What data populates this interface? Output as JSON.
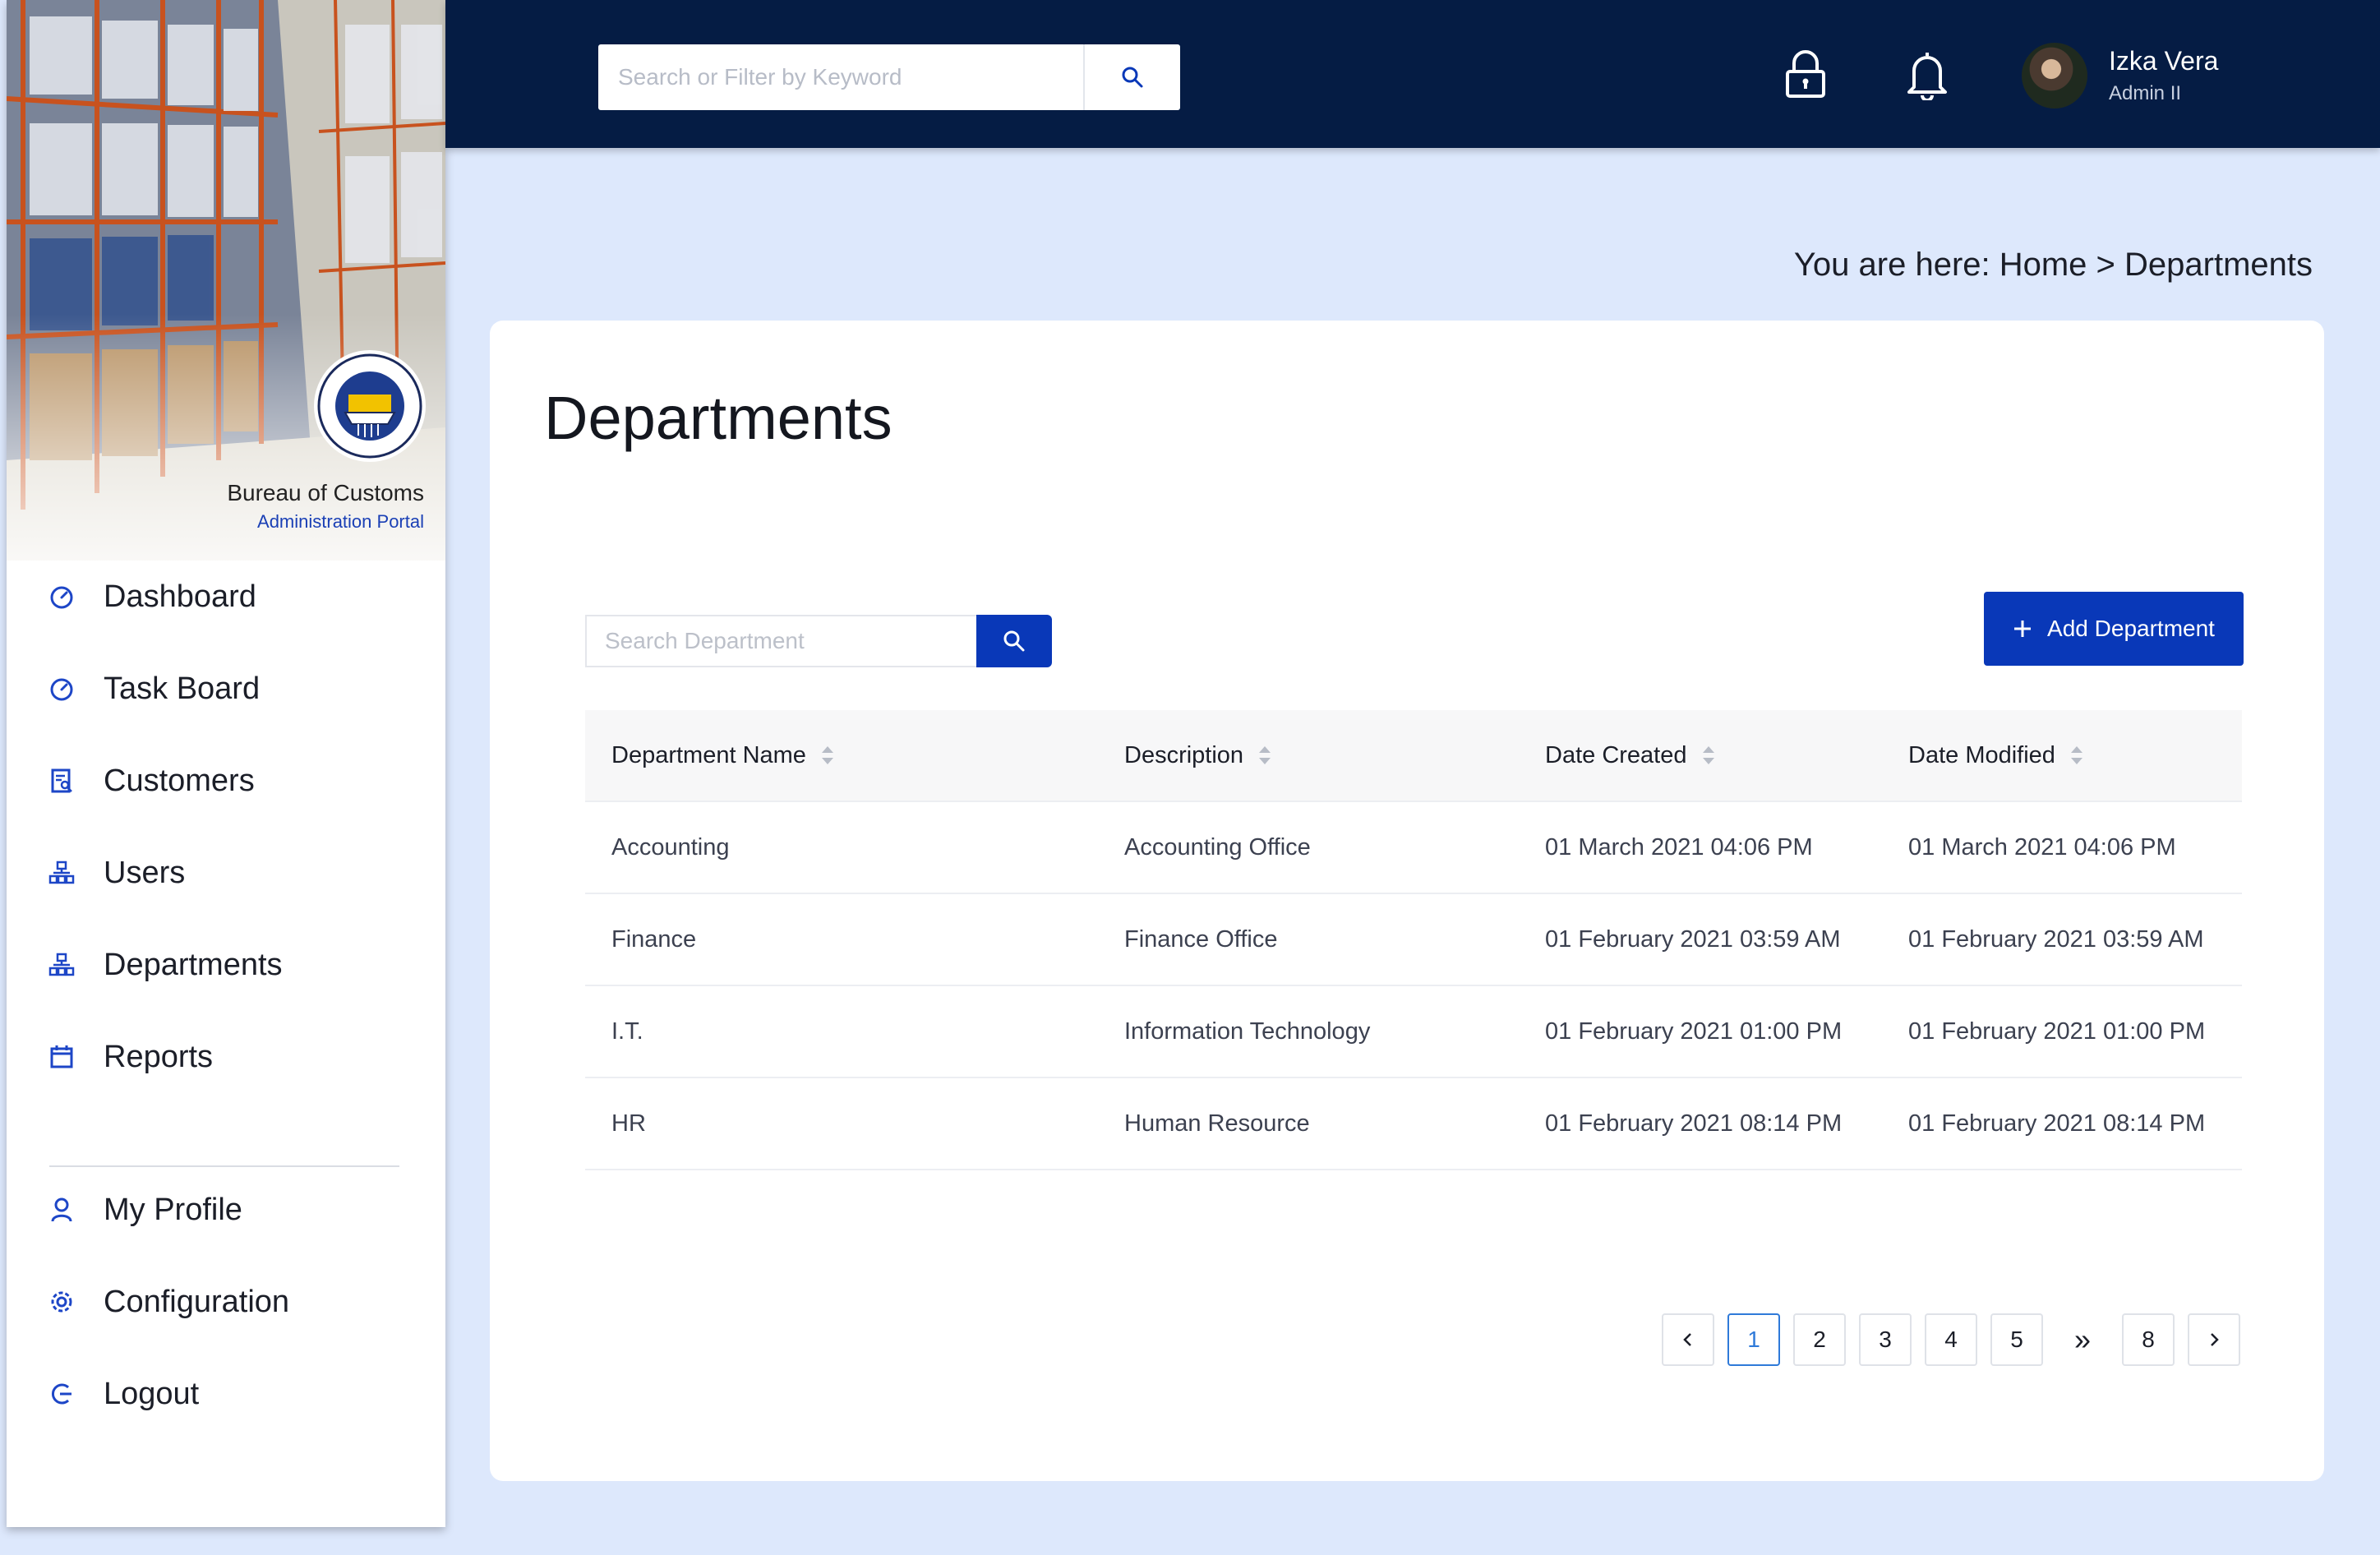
{
  "sidebar": {
    "org_name": "Bureau of Customs",
    "org_subtitle": "Administration Portal",
    "items": [
      {
        "label": "Dashboard",
        "icon": "dashboard-icon"
      },
      {
        "label": "Task Board",
        "icon": "dashboard-icon"
      },
      {
        "label": "Customers",
        "icon": "document-search-icon"
      },
      {
        "label": "Users",
        "icon": "org-chart-icon"
      },
      {
        "label": "Departments",
        "icon": "org-chart-icon"
      },
      {
        "label": "Reports",
        "icon": "calendar-icon"
      },
      {
        "label": "My Profile",
        "icon": "user-icon"
      },
      {
        "label": "Configuration",
        "icon": "gear-icon"
      },
      {
        "label": "Logout",
        "icon": "logout-icon"
      }
    ]
  },
  "topbar": {
    "search_placeholder": "Search or Filter by Keyword",
    "user_name": "Izka Vera",
    "user_role": "Admin II"
  },
  "breadcrumb": "You are here: Home > Departments",
  "page": {
    "title": "Departments",
    "search_placeholder": "Search Department",
    "add_button": "Add Department"
  },
  "table": {
    "columns": [
      "Department Name",
      "Description",
      "Date Created",
      "Date Modified"
    ],
    "rows": [
      [
        "Accounting",
        "Accounting Office",
        "01 March 2021 04:06 PM",
        "01 March 2021 04:06 PM"
      ],
      [
        "Finance",
        "Finance Office",
        "01 February 2021 03:59 AM",
        "01 February 2021 03:59 AM"
      ],
      [
        "I.T.",
        "Information Technology",
        "01 February 2021 01:00 PM",
        "01 February 2021 01:00 PM"
      ],
      [
        "HR",
        "Human Resource",
        "01 February 2021 08:14 PM",
        "01 February 2021 08:14 PM"
      ]
    ]
  },
  "pagination": {
    "pages": [
      "1",
      "2",
      "3",
      "4",
      "5"
    ],
    "current": "1",
    "ellipsis": "»",
    "last": "8"
  },
  "colors": {
    "topbar": "#051c44",
    "accent": "#0938b8",
    "background": "#dde8fc"
  }
}
